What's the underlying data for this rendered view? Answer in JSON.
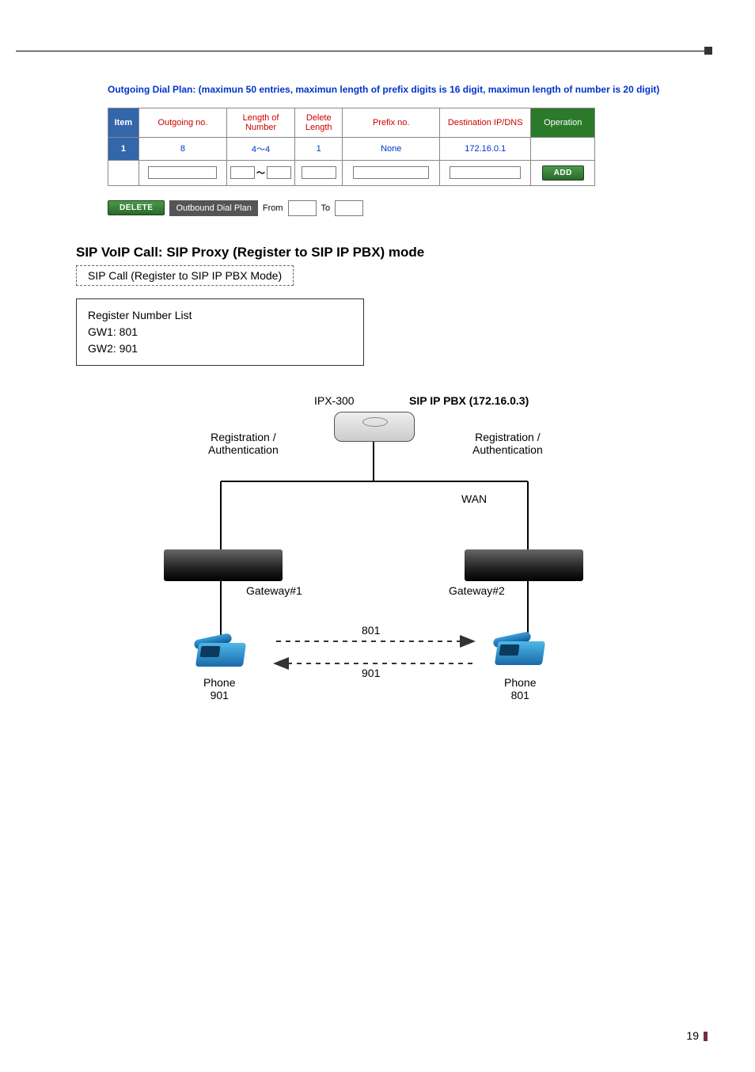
{
  "page_number": "19",
  "dial_plan": {
    "caption": "Outgoing Dial Plan: (maximun 50 entries, maximun length of prefix digits is 16 digit, maximun length of number is 20 digit)",
    "headers": {
      "item": "Item",
      "outgoing": "Outgoing no.",
      "length": "Length of Number",
      "delete": "Delete Length",
      "prefix": "Prefix no.",
      "dest": "Destination IP/DNS",
      "op": "Operation"
    },
    "row": {
      "item": "1",
      "outgoing": "8",
      "length": "4～4",
      "delete": "1",
      "prefix": "None",
      "dest": "172.16.0.1"
    },
    "length_separator": "～",
    "add_label": "ADD",
    "delete_label": "DELETE",
    "range_label": "Outbound Dial Plan",
    "from": "From",
    "to": "To"
  },
  "section": {
    "heading": "SIP VoIP Call: SIP Proxy (Register to SIP IP PBX) mode",
    "sip_call_label": "SIP Call (Register to SIP IP PBX Mode)",
    "reg_list_title": "Register Number List",
    "gw1": "GW1: 801",
    "gw2": "GW2: 901"
  },
  "diagram": {
    "ipx": "IPX-300",
    "pbx": "SIP IP PBX (172.16.0.3)",
    "reg_auth": "Registration /\nAuthentication",
    "wan": "WAN",
    "gw1": "Gateway#1",
    "gw2": "Gateway#2",
    "num1": "801",
    "num2": "901",
    "phone1": "Phone\n901",
    "phone2": "Phone\n801"
  }
}
